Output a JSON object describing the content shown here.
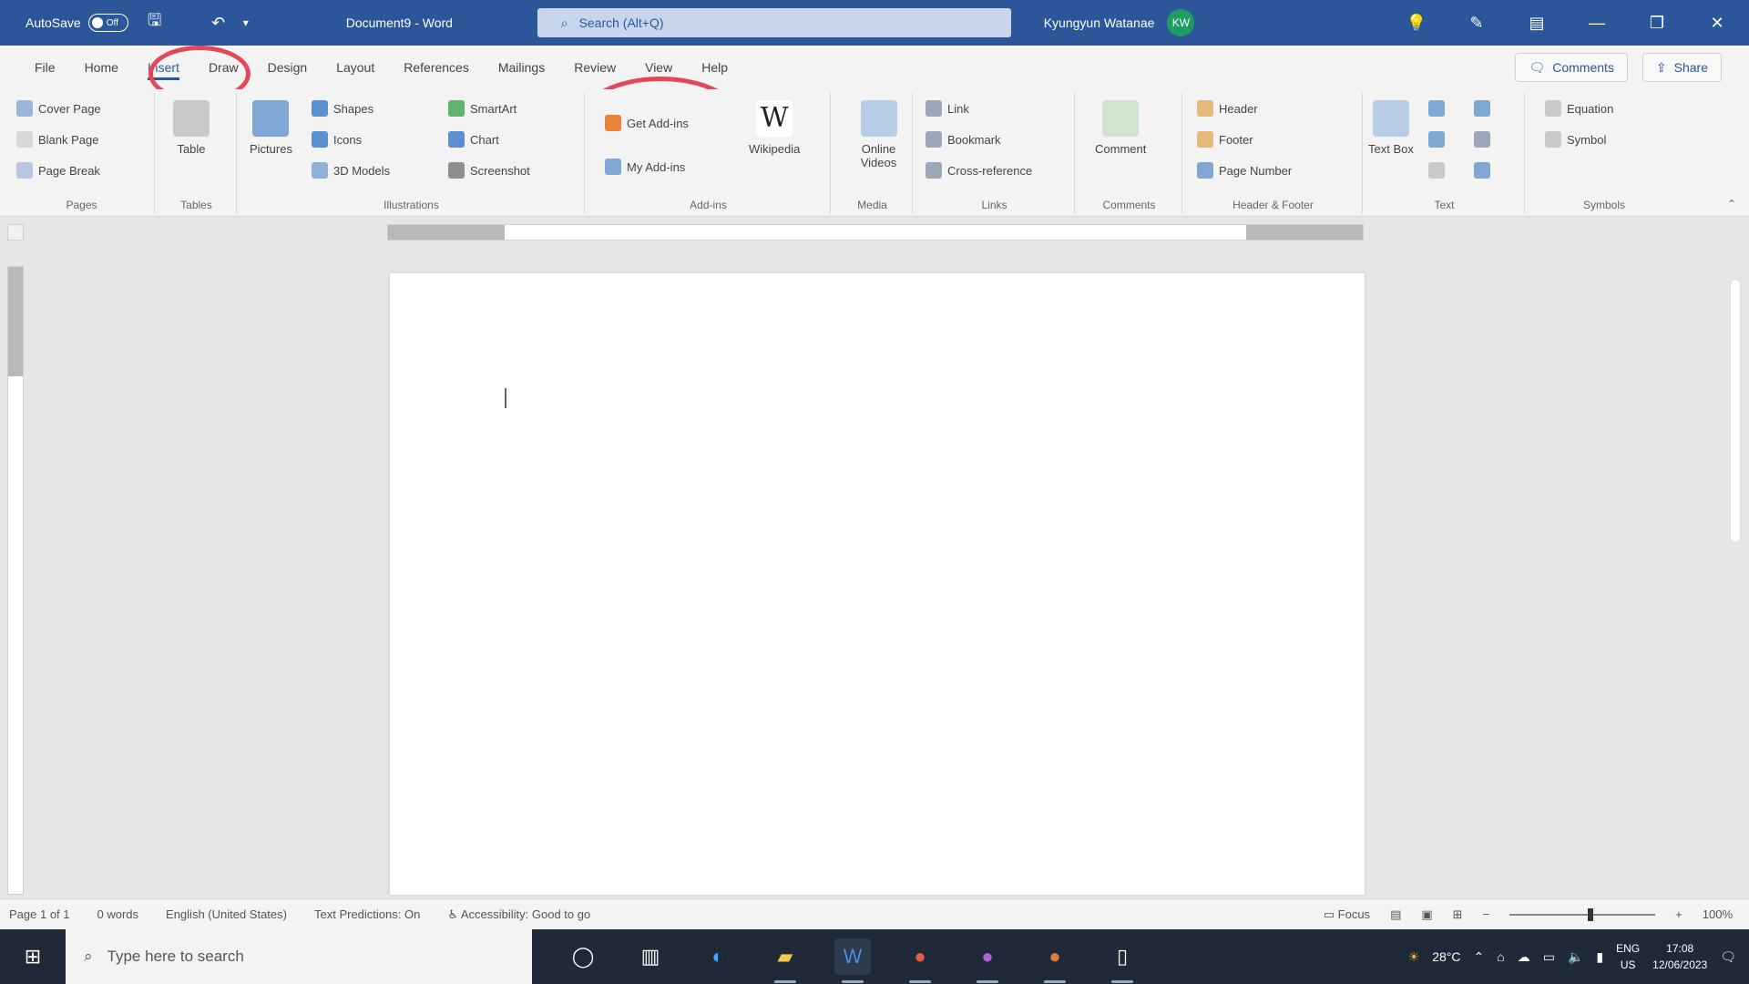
{
  "titlebar": {
    "autosave_label": "AutoSave",
    "toggle_label": "Off",
    "document_title": "Document9 - Word",
    "search_placeholder": "Search (Alt+Q)",
    "user_name": "Kyungyun Watanae",
    "avatar_initials": "KW"
  },
  "tabs": [
    "File",
    "Home",
    "Insert",
    "Draw",
    "Design",
    "Layout",
    "References",
    "Mailings",
    "Review",
    "View",
    "Help"
  ],
  "active_tab": "Insert",
  "tabs_right": {
    "comments": "Comments",
    "share": "Share"
  },
  "ribbon": {
    "pages": {
      "label": "Pages",
      "items": [
        "Cover Page",
        "Blank Page",
        "Page Break"
      ]
    },
    "tables": {
      "label": "Tables",
      "table": "Table"
    },
    "illustrations": {
      "label": "Illustrations",
      "pictures": "Pictures",
      "shapes": "Shapes",
      "icons": "Icons",
      "models": "3D Models",
      "smartart": "SmartArt",
      "chart": "Chart",
      "screenshot": "Screenshot"
    },
    "addins": {
      "label": "Add-ins",
      "get": "Get Add-ins",
      "my": "My Add-ins",
      "wikipedia": "Wikipedia"
    },
    "media": {
      "label": "Media",
      "online_videos": "Online Videos"
    },
    "links": {
      "label": "Links",
      "link": "Link",
      "bookmark": "Bookmark",
      "crossref": "Cross-reference"
    },
    "comments": {
      "label": "Comments",
      "comment": "Comment"
    },
    "headerfooter": {
      "label": "Header & Footer",
      "header": "Header",
      "footer": "Footer",
      "pagenum": "Page Number"
    },
    "text": {
      "label": "Text",
      "textbox": "Text Box"
    },
    "symbols": {
      "label": "Symbols",
      "equation": "Equation",
      "symbol": "Symbol"
    }
  },
  "statusbar": {
    "page": "Page 1 of 1",
    "words": "0 words",
    "language": "English (United States)",
    "predictions": "Text Predictions: On",
    "accessibility": "Accessibility: Good to go",
    "focus": "Focus",
    "zoom": "100%"
  },
  "taskbar": {
    "search_placeholder": "Type here to search",
    "weather": "28°C",
    "lang": "ENG",
    "region": "US",
    "time": "17:08",
    "date": "12/06/2023"
  }
}
